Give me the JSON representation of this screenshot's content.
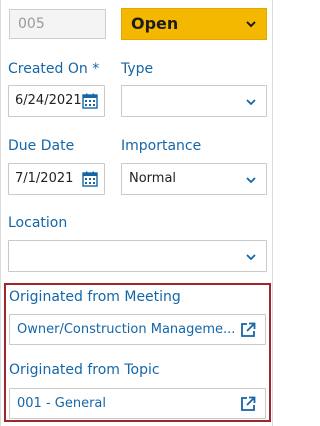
{
  "record": {
    "number": "005"
  },
  "status": {
    "value": "Open",
    "color": "#f5b800"
  },
  "created_on": {
    "label": "Created On *",
    "value": "6/24/2021"
  },
  "type": {
    "label": "Type",
    "value": ""
  },
  "due_date": {
    "label": "Due Date",
    "value": "7/1/2021"
  },
  "importance": {
    "label": "Importance",
    "value": "Normal"
  },
  "location": {
    "label": "Location",
    "value": ""
  },
  "originated_meeting": {
    "label": "Originated from Meeting",
    "value": "Owner/Construction Manageme..."
  },
  "originated_topic": {
    "label": "Originated from Topic",
    "value": "001 - General"
  },
  "colors": {
    "accent": "#1466a8",
    "highlight_border": "#a0262e"
  },
  "icons": {
    "dropdown": "chevron-down-icon",
    "calendar": "calendar-icon",
    "open_link": "external-link-icon"
  }
}
